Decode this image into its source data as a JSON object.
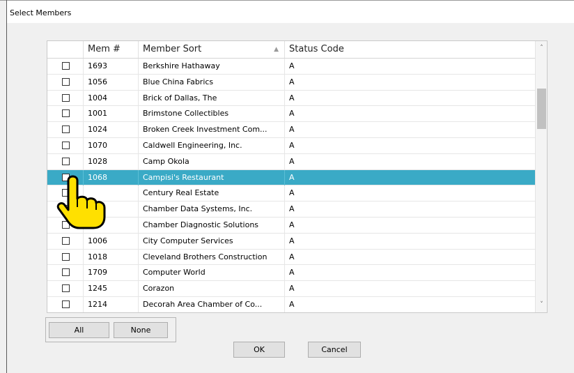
{
  "window": {
    "title": "Select Members"
  },
  "grid": {
    "columns": [
      "",
      "Mem #",
      "Member Sort",
      "Status Code"
    ],
    "sort_indicator": "▲",
    "rows": [
      {
        "mem": "1693",
        "name": "Berkshire Hathaway",
        "status": "A"
      },
      {
        "mem": "1056",
        "name": "Blue China Fabrics",
        "status": "A"
      },
      {
        "mem": "1004",
        "name": "Brick of Dallas, The",
        "status": "A"
      },
      {
        "mem": "1001",
        "name": "Brimstone Collectibles",
        "status": "A"
      },
      {
        "mem": "1024",
        "name": "Broken Creek Investment Com...",
        "status": "A"
      },
      {
        "mem": "1070",
        "name": "Caldwell Engineering, Inc.",
        "status": "A"
      },
      {
        "mem": "1028",
        "name": "Camp Okola",
        "status": "A"
      },
      {
        "mem": "1068",
        "name": "Campisi's Restaurant",
        "status": "A",
        "selected": true
      },
      {
        "mem": "",
        "name": "Century Real Estate",
        "status": "A"
      },
      {
        "mem": "",
        "name": "Chamber Data Systems, Inc.",
        "status": "A"
      },
      {
        "mem": "",
        "name": "Chamber Diagnostic Solutions",
        "status": "A"
      },
      {
        "mem": "1006",
        "name": "City Computer Services",
        "status": "A"
      },
      {
        "mem": "1018",
        "name": "Cleveland Brothers Construction",
        "status": "A"
      },
      {
        "mem": "1709",
        "name": "Computer World",
        "status": "A"
      },
      {
        "mem": "1245",
        "name": "Corazon",
        "status": "A"
      },
      {
        "mem": "1214",
        "name": "Decorah Area Chamber of Co...",
        "status": "A"
      }
    ],
    "selection_color": "#3aaac6"
  },
  "scrollbar": {
    "up_icon": "chevron-up-icon",
    "down_icon": "chevron-down-icon",
    "up_glyph": "˄",
    "down_glyph": "˅"
  },
  "buttons": {
    "all": "All",
    "none": "None",
    "ok": "OK",
    "cancel": "Cancel"
  },
  "cursor": {
    "icon": "pointing-hand-icon",
    "color": "#ffe000"
  }
}
